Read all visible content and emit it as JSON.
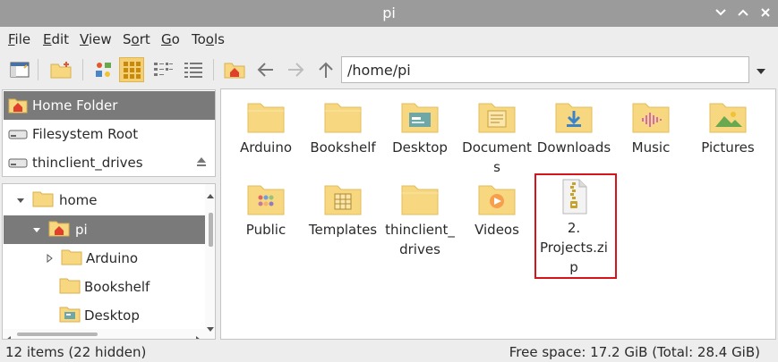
{
  "window": {
    "title": "pi"
  },
  "menu": [
    {
      "mnemonic": "F",
      "rest": "ile"
    },
    {
      "mnemonic": "E",
      "rest": "dit"
    },
    {
      "mnemonic": "V",
      "rest": "iew"
    },
    {
      "pre": "S",
      "mnemonic": "o",
      "rest": "rt"
    },
    {
      "mnemonic": "G",
      "rest": "o"
    },
    {
      "pre": "To",
      "mnemonic": "o",
      "rest": "ls"
    }
  ],
  "path": {
    "value": "/home/pi"
  },
  "places": [
    {
      "label": "Home Folder",
      "icon": "home-folder-icon",
      "selected": true
    },
    {
      "label": "Filesystem Root",
      "icon": "drive-icon"
    },
    {
      "label": "thinclient_drives",
      "icon": "drive-icon",
      "eject": true
    }
  ],
  "tree": [
    {
      "label": "home",
      "expanded": true
    },
    {
      "label": "pi",
      "expanded": true,
      "selected": true
    },
    {
      "label": "Arduino",
      "collapsed": true
    },
    {
      "label": "Bookshelf"
    },
    {
      "label": "Desktop"
    }
  ],
  "files": [
    {
      "lines": [
        "Arduino"
      ],
      "icon": "folder"
    },
    {
      "lines": [
        "Bookshelf"
      ],
      "icon": "folder"
    },
    {
      "lines": [
        "Desktop"
      ],
      "icon": "desktop"
    },
    {
      "lines": [
        "Document",
        "s"
      ],
      "icon": "documents"
    },
    {
      "lines": [
        "Downloads"
      ],
      "icon": "downloads"
    },
    {
      "lines": [
        "Music"
      ],
      "icon": "music"
    },
    {
      "lines": [
        "Pictures"
      ],
      "icon": "pictures"
    },
    {
      "lines": [
        "Public"
      ],
      "icon": "public"
    },
    {
      "lines": [
        "Templates"
      ],
      "icon": "templates"
    },
    {
      "lines": [
        "thinclient_",
        "drives"
      ],
      "icon": "folder"
    },
    {
      "lines": [
        "Videos"
      ],
      "icon": "videos"
    },
    {
      "lines": [
        "2.",
        "Projects.zi",
        "p"
      ],
      "icon": "zip"
    }
  ],
  "status": {
    "items": "12 items (22 hidden)",
    "free": "Free space: 17.2 GiB (Total: 28.4 GiB)"
  },
  "colors": {
    "highlight": "#d9131a",
    "folder": "#f7d77f",
    "selection": "#7a7a7a"
  }
}
